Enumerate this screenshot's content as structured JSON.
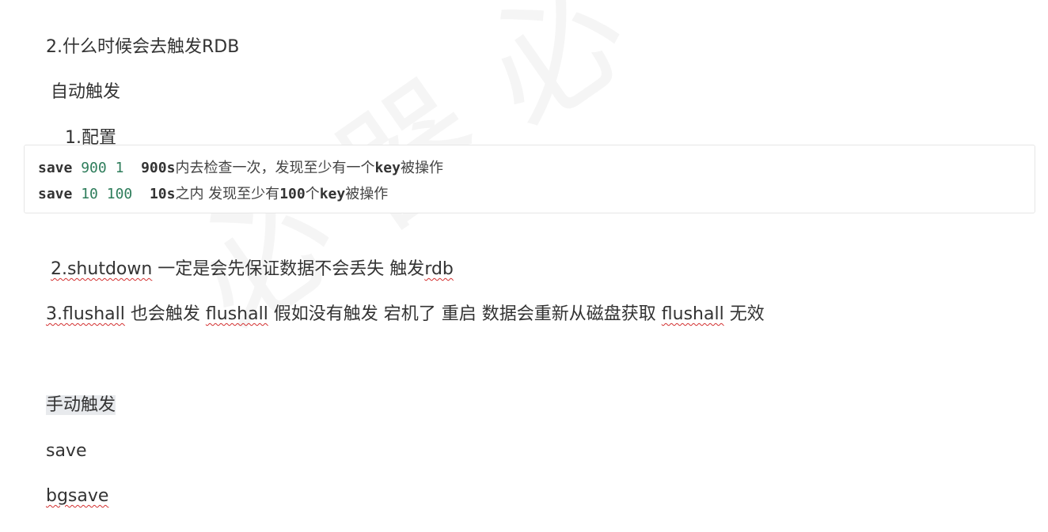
{
  "heading_trigger": "2.什么时候会去触发RDB",
  "auto_trigger": "自动触发",
  "config": "1.配置",
  "code": {
    "line1": {
      "cmd": "save",
      "n1": "900",
      "n2": "1",
      "comment_num": "900s",
      "comment_a": "内去检查一次，发现至少有一个",
      "comment_key": "key",
      "comment_b": "被操作"
    },
    "line2": {
      "cmd": "save",
      "n1": "10",
      "n2": "100",
      "comment_num": "10s",
      "comment_a": "之内 发现至少有",
      "comment_num2": "100",
      "comment_c": "个",
      "comment_key": "key",
      "comment_b": "被操作"
    }
  },
  "shutdown": {
    "link": "2.shutdown",
    "text": " 一定是会先保证数据不会丢失 触发",
    "rdb": "rdb"
  },
  "flushall": {
    "t1": "3.flushall",
    "t2": " 也会触发 ",
    "t3": "flushall",
    "t4": " 假如没有触发 宕机了 重启 数据会重新从磁盘获取 ",
    "t5": "flushall",
    "t6": " 无效"
  },
  "manual_trigger": "手动触发",
  "save": "save",
  "bgsave": "bgsave"
}
